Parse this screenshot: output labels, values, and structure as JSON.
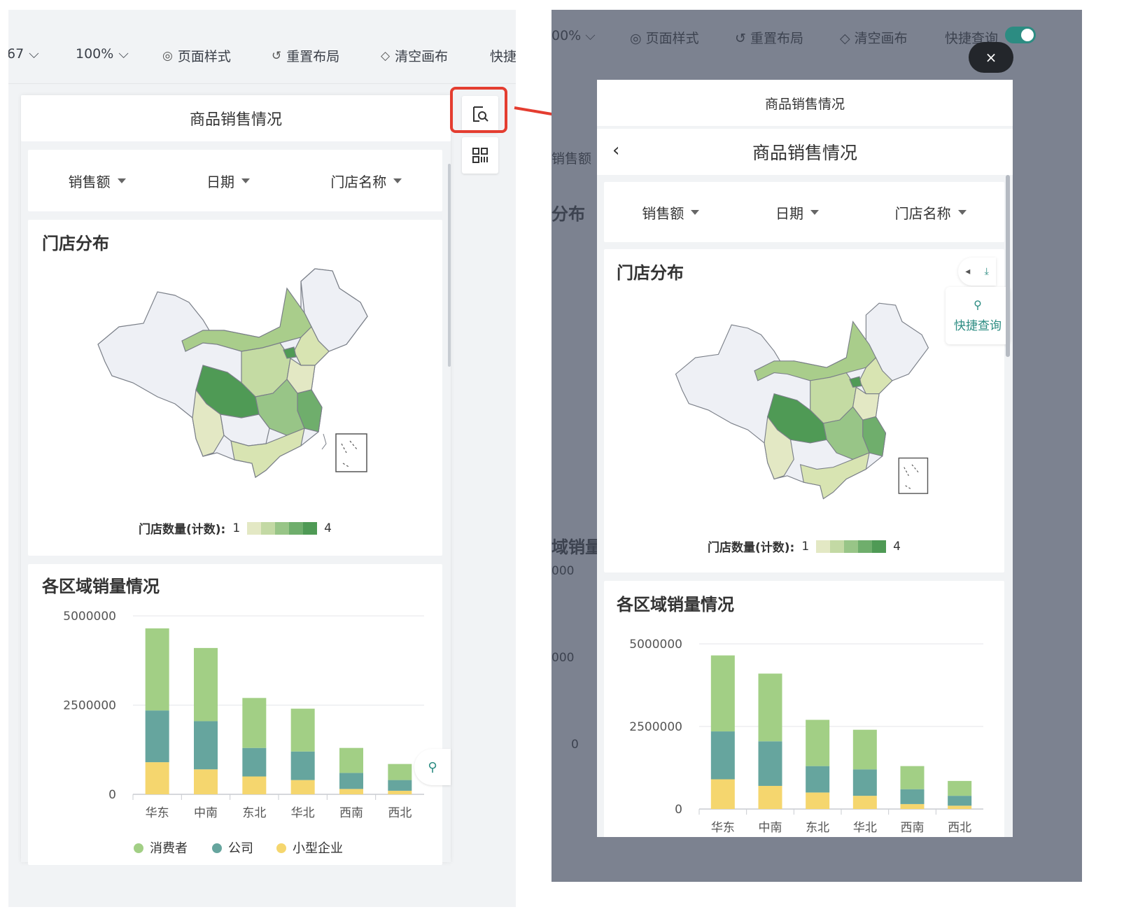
{
  "left": {
    "toolbar": {
      "zoom_prev_partial": "67",
      "zoom": "100%",
      "page_style": "页面样式",
      "reset_layout": "重置布局",
      "clear_canvas": "清空画布",
      "quick_partial": "快捷"
    },
    "report_title": "商品销售情况",
    "filters": [
      "销售额",
      "日期",
      "门店名称"
    ],
    "map_card": {
      "title": "门店分布",
      "legend_label": "门店数量(计数):",
      "legend_min": "1",
      "legend_max": "4",
      "legend_colors": [
        "#e3e8c4",
        "#c3d9a4",
        "#98c587",
        "#6fae6c",
        "#4f9a55"
      ]
    },
    "chart_card": {
      "title": "各区域销量情况"
    }
  },
  "right": {
    "toolbar": {
      "zoom_partial": "00%",
      "page_style": "页面样式",
      "reset_layout": "重置布局",
      "clear_canvas": "清空画布",
      "quick_query": "快捷查询",
      "quick_query_enabled": true
    },
    "close_label": "×",
    "bg_fragments": [
      "销售额",
      "分布",
      "域销量",
      "000",
      "000",
      "0"
    ],
    "phone": {
      "header_title": "商品销售情况",
      "back_title": "商品销售情况",
      "filters": [
        "销售额",
        "日期",
        "门店名称"
      ],
      "map_title": "门店分布",
      "quick_query_label": "快捷查询",
      "legend_label": "门店数量(计数):",
      "legend_min": "1",
      "legend_max": "4",
      "chart_title": "各区域销量情况"
    }
  },
  "chart_data": {
    "type": "bar",
    "stacked": true,
    "title": "各区域销量情况",
    "categories": [
      "华东",
      "中南",
      "东北",
      "华北",
      "西南",
      "西北"
    ],
    "series": [
      {
        "name": "小型企业",
        "color": "#f5d66e",
        "values": [
          900000,
          700000,
          500000,
          400000,
          150000,
          100000
        ]
      },
      {
        "name": "公司",
        "color": "#66a59e",
        "values": [
          1450000,
          1350000,
          800000,
          800000,
          450000,
          300000
        ]
      },
      {
        "name": "消费者",
        "color": "#a2cf85",
        "values": [
          2300000,
          2050000,
          1400000,
          1200000,
          700000,
          450000
        ]
      }
    ],
    "legend_order": [
      "消费者",
      "公司",
      "小型企业"
    ],
    "y_ticks": [
      "0",
      "2500000",
      "5000000"
    ],
    "ylim": [
      0,
      5000000
    ],
    "grid": true,
    "legend_position": "bottom"
  }
}
